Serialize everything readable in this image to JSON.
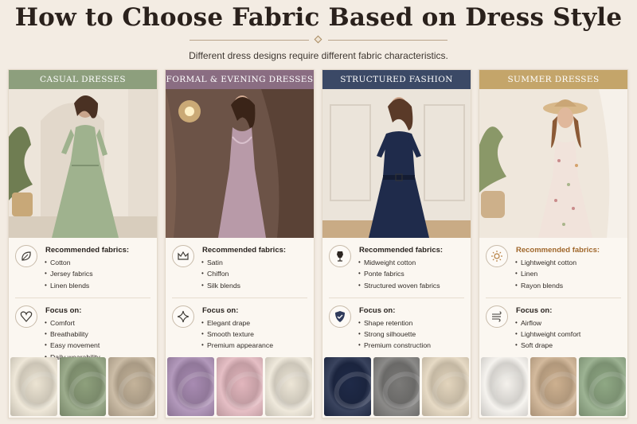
{
  "title": "How to Choose Fabric Based on Dress Style",
  "subtitle": "Different dress designs require different fabric characteristics.",
  "cards": [
    {
      "header": "CASUAL DRESSES",
      "header_color": "#8d9f7d",
      "recommended_label": "Recommended fabrics:",
      "recommended": [
        "Cotton",
        "Jersey fabrics",
        "Linen blends"
      ],
      "focus_label": "Focus on:",
      "focus": [
        "Comfort",
        "Breathability",
        "Easy movement",
        "Daily wearability"
      ],
      "icons": [
        "leaf-icon",
        "heart-icon"
      ],
      "swatches": [
        "#ece4d3",
        "#8ea07c",
        "#c4b39a"
      ]
    },
    {
      "header": "FORMAL & EVENING DRESSES",
      "header_color": "#8a6d82",
      "recommended_label": "Recommended fabrics:",
      "recommended": [
        "Satin",
        "Chiffon",
        "Silk blends"
      ],
      "focus_label": "Focus on:",
      "focus": [
        "Elegant drape",
        "Smooth texture",
        "Premium appearance"
      ],
      "icons": [
        "crown-icon",
        "sparkle-icon"
      ],
      "swatches": [
        "#a88bb2",
        "#e2b6bd",
        "#ede6d7"
      ]
    },
    {
      "header": "STRUCTURED FASHION DRESSES",
      "header_color": "#3b4966",
      "recommended_label": "Recommended fabrics:",
      "recommended": [
        "Midweight cotton",
        "Ponte fabrics",
        "Structured woven fabrics"
      ],
      "focus_label": "Focus on:",
      "focus": [
        "Shape retention",
        "Strong silhouette",
        "Premium construction"
      ],
      "icons": [
        "dress-form-icon",
        "shield-icon"
      ],
      "swatches": [
        "#1f2a48",
        "#7b7a78",
        "#e3d5bd"
      ]
    },
    {
      "header": "SUMMER DRESSES",
      "header_color": "#c4a56a",
      "recommended_label": "Recommended fabrics:",
      "recommended": [
        "Lightweight cotton",
        "Linen",
        "Rayon blends"
      ],
      "focus_label": "Focus on:",
      "focus": [
        "Airflow",
        "Lightweight comfort",
        "Soft drape"
      ],
      "icons": [
        "sun-icon",
        "wind-icon"
      ],
      "label_color": "#a0672b",
      "swatches": [
        "#f4f1ec",
        "#cdb08f",
        "#8fa884"
      ]
    }
  ]
}
